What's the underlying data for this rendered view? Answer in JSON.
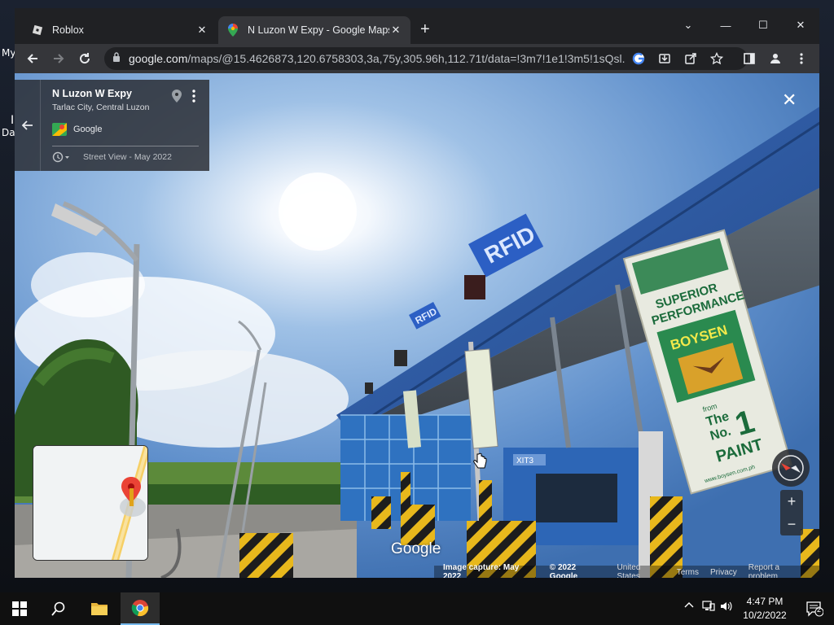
{
  "desktop": {
    "label1": "My",
    "label2": "I",
    "label3": "Da"
  },
  "tabs": [
    {
      "label": "Roblox",
      "icon": "roblox-icon",
      "close": "✕"
    },
    {
      "label": "N Luzon W Expy - Google Maps",
      "icon": "google-maps-icon",
      "close": "✕"
    }
  ],
  "newtab": "+",
  "window_controls": {
    "dropdown": "⌄",
    "minimize": "—",
    "maximize": "☐",
    "close": "✕"
  },
  "toolbar": {
    "url_host": "google.com",
    "url_path": "/maps/@15.4626873,120.6758303,3a,75y,305.96h,112.71t/data=!3m7!1e1!3m5!1sQsl..."
  },
  "streetview": {
    "title": "N Luzon W Expy",
    "subtitle": "Tarlac City, Central Luzon",
    "provider": "Google",
    "history": "Street View - May 2022",
    "watermark": "Google",
    "close": "✕"
  },
  "map_controls": {
    "zoom_in": "+",
    "zoom_out": "−"
  },
  "scene_text": {
    "rfid1": "RFID",
    "rfid2": "RFID",
    "billboard_line1": "SUPERIOR",
    "billboard_line2": "PERFORMANCE",
    "billboard_brand": "BOYSEN",
    "billboard_from": "from",
    "billboard_the": "The",
    "billboard_no": "No.",
    "billboard_one": "1",
    "billboard_paint": "PAINT",
    "billboard_url": "www.boysen.com.ph",
    "booth_label": "XIT3"
  },
  "footer": {
    "capture": "Image capture: May 2022",
    "copyright": "© 2022 Google",
    "country": "United States",
    "terms": "Terms",
    "privacy": "Privacy",
    "report": "Report a problem"
  },
  "taskbar": {
    "time": "4:47 PM",
    "date": "10/2/2022",
    "notifications": "2"
  }
}
